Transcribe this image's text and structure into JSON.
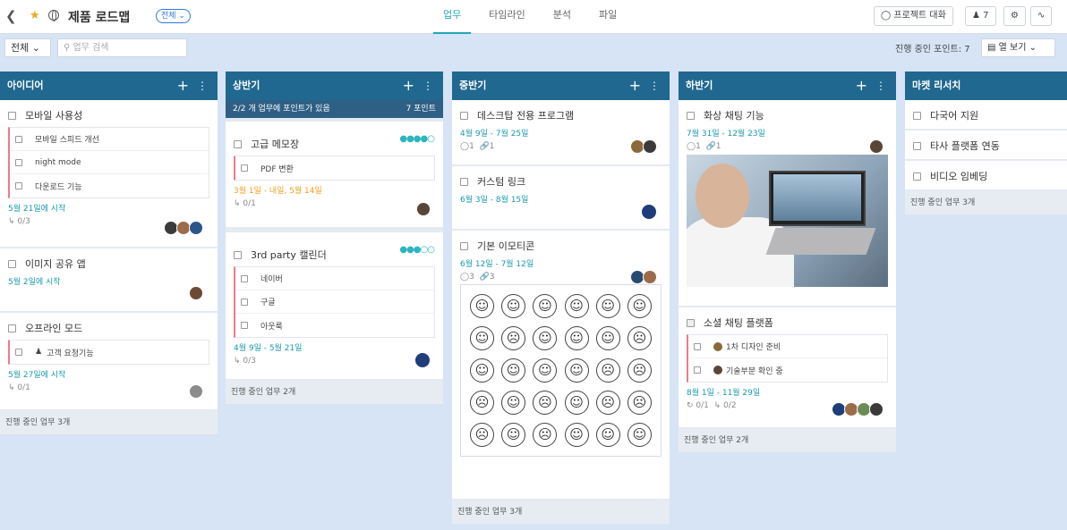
{
  "header": {
    "back_icon": "chevron-left-icon",
    "title": "제품 로드맵",
    "scope": "전체",
    "tabs": [
      "업무",
      "타임라인",
      "분석",
      "파일"
    ],
    "active_tab": "업무",
    "project_chat": "프로젝트 대화",
    "members_count": "7"
  },
  "toolbar": {
    "filter": "전체",
    "search_placeholder": "업무 검색",
    "points": "진행 중인 포인트: 7",
    "view": "열 보기"
  },
  "columns": [
    {
      "title": "아이디어",
      "cards": [
        {
          "title": "모바일 사용성",
          "subtasks": [
            "모바일 스피드 개선",
            "night mode",
            "다운로드 기능"
          ],
          "date": "5월 21일에 시작",
          "meta": "0/3"
        },
        {
          "title": "이미지 공유 앱",
          "date": "5월 2일에 시작"
        },
        {
          "title": "오프라인 모드",
          "subtasks": [
            "고객 요청기능"
          ],
          "date": "5월 27일에 시작",
          "meta": "0/1"
        }
      ],
      "footer": "진행 중인 업무 3개"
    },
    {
      "title": "상반기",
      "points_info": {
        "left": "2/2 개 업무에 포인트가 있음",
        "right": "7 포인트"
      },
      "cards": [
        {
          "title": "고급 메모장",
          "subtasks": [
            "PDF 변환"
          ],
          "date": "3월 1일 - 내일, 5월 14일",
          "meta": "0/1"
        },
        {
          "title": "3rd party 캘린더",
          "subtasks": [
            "네이버",
            "구글",
            "아웃룩"
          ],
          "date": "4월 9일 - 5월 21일",
          "meta": "0/3"
        }
      ],
      "footer": "진행 중인 업무 2개"
    },
    {
      "title": "중반기",
      "cards": [
        {
          "title": "데스크탑 전용 프로그램",
          "date": "4월 9일 - 7월 25일",
          "comments": "1",
          "links": "1"
        },
        {
          "title": "커스텀 링크",
          "date": "6월 3일 - 8월 15일"
        },
        {
          "title": "기본 이모티콘",
          "date": "6월 12일 - 7월 12일",
          "comments": "3",
          "links": "3"
        }
      ],
      "emojis": [
        "☺",
        "☺",
        "☺",
        "☺",
        "☺",
        "☺",
        "☺",
        "☹",
        "☺",
        "☺",
        "☺",
        "☹",
        "☺",
        "☺",
        "☺",
        "☺",
        "☹",
        "☹",
        "☹",
        "☺",
        "☹",
        "☺",
        "☹",
        "☹",
        "☹",
        "☺",
        "☹",
        "☺",
        "☺",
        "☺"
      ],
      "footer": "진행 중인 업무 3개"
    },
    {
      "title": "하반기",
      "cards": [
        {
          "title": "화상 채팅 기능",
          "date": "7월 31일 - 12월 23일",
          "comments": "1",
          "links": "1"
        },
        {
          "title": "소셜 채팅 플랫폼",
          "subtasks": [
            "1차 디자인 준비",
            "기술부분 확인 중"
          ],
          "date": "8월 1일 - 11월 29일",
          "meta": "0/1",
          "meta2": "0/2"
        }
      ],
      "footer": "진행 중인 업무 2개"
    },
    {
      "title": "마켓 리서치",
      "cards": [
        {
          "title": "다국어 지원"
        },
        {
          "title": "타사 플랫폼 연동"
        },
        {
          "title": "비디오 임베딩"
        }
      ],
      "footer": "진행 중인 업무 3개"
    }
  ]
}
